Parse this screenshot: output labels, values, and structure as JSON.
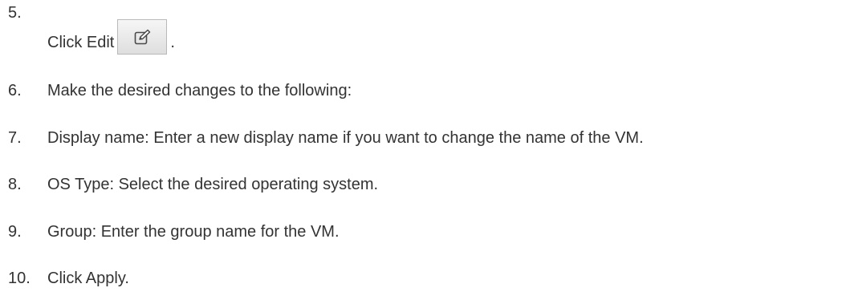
{
  "steps": [
    {
      "number": "5.",
      "text_before_icon": "Click Edit",
      "icon": "edit-icon",
      "text_after_icon": "."
    },
    {
      "number": "6.",
      "text": "Make the desired changes to the following:"
    },
    {
      "number": "7.",
      "text": "Display name: Enter a new display name if you want to change the name of the VM."
    },
    {
      "number": "8.",
      "text": "OS Type: Select the desired operating system."
    },
    {
      "number": "9.",
      "text": "Group: Enter the group name for the VM."
    },
    {
      "number": "10.",
      "text": "Click Apply."
    }
  ]
}
